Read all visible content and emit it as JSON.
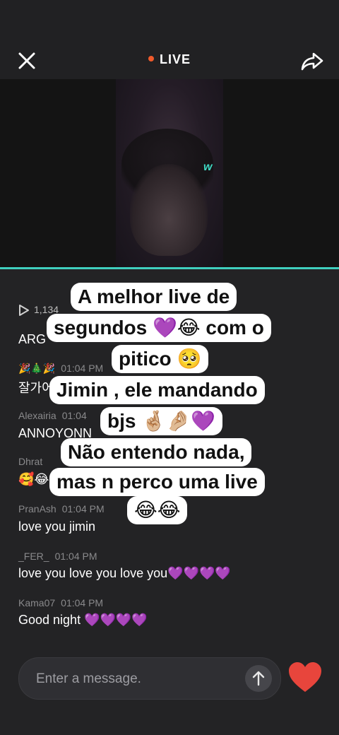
{
  "header": {
    "live_label": "LIVE",
    "close_icon": "close-icon",
    "share_icon": "share-icon"
  },
  "video": {
    "logo": "w"
  },
  "viewers": {
    "count": "1,134"
  },
  "messages": [
    {
      "user": "",
      "time": "",
      "text": "ARG"
    },
    {
      "user": "🎉🎄🎉",
      "time": "01:04 PM",
      "text": "잘가어"
    },
    {
      "user": "Alexairia",
      "time": "01:04",
      "text": "ANNOYONN"
    },
    {
      "user": "Dhrat",
      "time": "",
      "text": "🥰😂"
    },
    {
      "user": "PranAsh",
      "time": "01:04 PM",
      "text": "love you jimin"
    },
    {
      "user": "_FER_",
      "time": "01:04 PM",
      "text": "love you love you love you💜💜💜💜"
    },
    {
      "user": "Kama07",
      "time": "01:04 PM",
      "text": "Good night 💜💜💜💜"
    }
  ],
  "overlay": {
    "lines": [
      "A melhor live de",
      "segundos 💜😂 com o",
      "pitico 🥺",
      "Jimin , ele mandando",
      "bjs 🤞🏼🤌🏼💜",
      "Não entendo nada,",
      "mas n perco uma live",
      "😂😂"
    ]
  },
  "composer": {
    "placeholder": "Enter a message."
  },
  "colors": {
    "accent": "#3fcfbe",
    "live_dot": "#f05a2b",
    "like": "#e8453c"
  }
}
